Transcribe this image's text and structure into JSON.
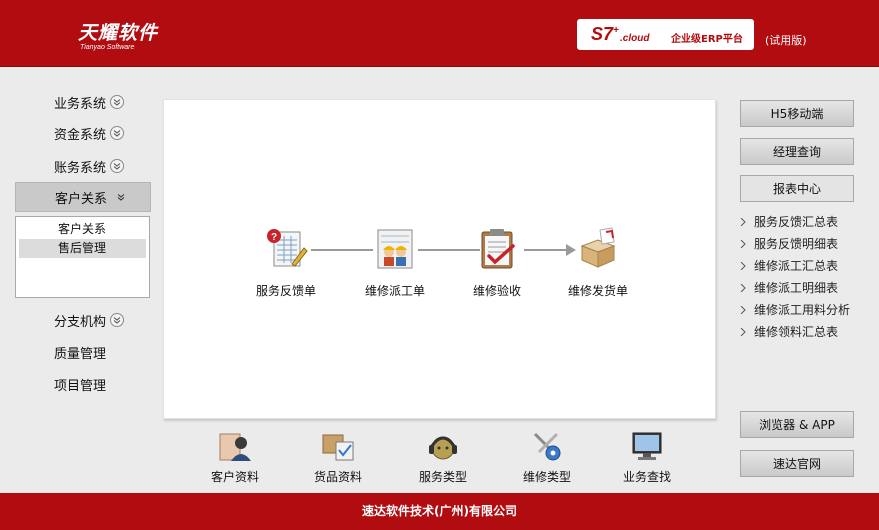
{
  "header": {
    "logo_cn": "天耀软件",
    "logo_en": "Tianyao Software",
    "brand_s7": "S7",
    "brand_plus": "+",
    "brand_cloud": ".cloud",
    "brand_sub": "企业级ERP平台",
    "trial": "(试用版)"
  },
  "nav": {
    "items": [
      {
        "label": "业务系统"
      },
      {
        "label": "资金系统"
      },
      {
        "label": "账务系统"
      },
      {
        "label": "客户关系"
      },
      {
        "label": "分支机构"
      },
      {
        "label": "质量管理"
      },
      {
        "label": "项目管理"
      }
    ],
    "submenu": [
      {
        "label": "客户关系"
      },
      {
        "label": "售后管理"
      }
    ]
  },
  "flow": [
    {
      "label": "服务反馈单",
      "icon": "feedback-form-icon"
    },
    {
      "label": "维修派工单",
      "icon": "dispatch-workers-icon"
    },
    {
      "label": "维修验收",
      "icon": "clipboard-check-icon"
    },
    {
      "label": "维修发货单",
      "icon": "shipping-box-icon"
    }
  ],
  "bottom": [
    {
      "label": "客户资料",
      "icon": "customer-profile-icon"
    },
    {
      "label": "货品资料",
      "icon": "goods-box-icon"
    },
    {
      "label": "服务类型",
      "icon": "headset-icon"
    },
    {
      "label": "维修类型",
      "icon": "tools-gear-icon"
    },
    {
      "label": "业务查找",
      "icon": "monitor-search-icon"
    }
  ],
  "right": {
    "buttons": [
      "H5移动端",
      "经理查询",
      "报表中心"
    ],
    "reports": [
      "服务反馈汇总表",
      "服务反馈明细表",
      "维修派工汇总表",
      "维修派工明细表",
      "维修派工用料分析",
      "维修领料汇总表"
    ],
    "bottom_buttons": [
      "浏览器 & APP",
      "速达官网"
    ]
  },
  "footer": {
    "text": "速达软件技术(广州)有限公司"
  },
  "colors": {
    "brand_red": "#b10c10",
    "page_bg": "#ebebeb"
  }
}
